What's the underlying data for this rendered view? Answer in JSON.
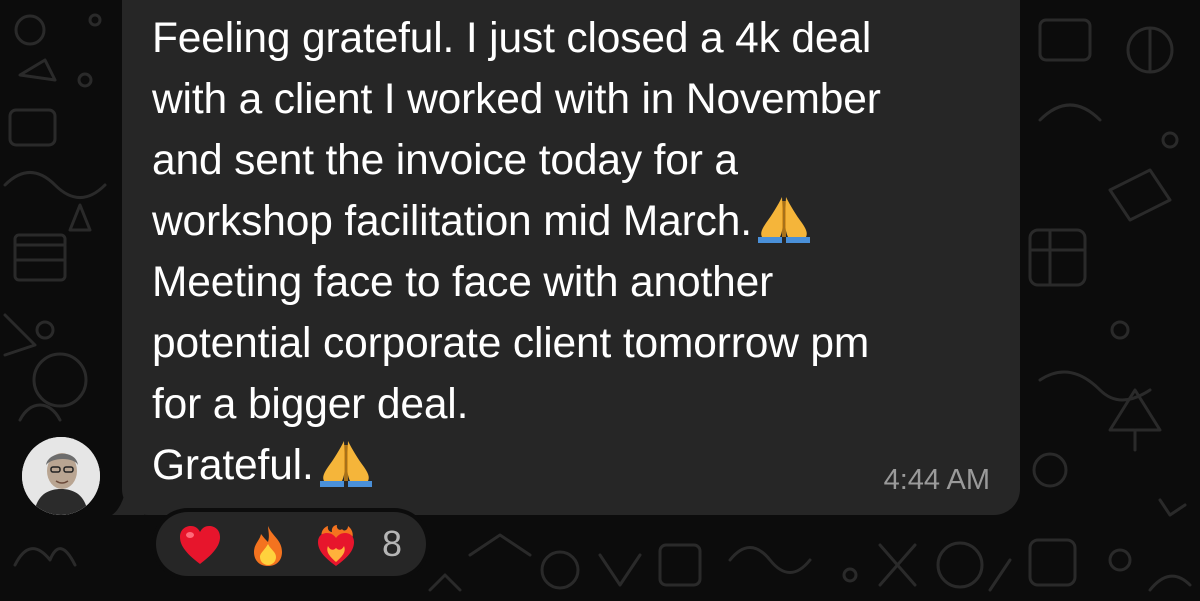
{
  "message": {
    "text_lines": [
      "Feeling grateful. I just closed a 4k deal",
      "with a client I worked with in November",
      "and sent the invoice today for a",
      "workshop facilitation mid March.",
      "Meeting face to face with another",
      "potential corporate client tomorrow pm",
      "for a bigger deal.",
      "Grateful."
    ],
    "emoji_after_line_4": "pray-emoji",
    "emoji_after_line_8": "pray-emoji",
    "timestamp": "4:44 AM"
  },
  "sender": {
    "avatar": "avatar-photo"
  },
  "reactions": {
    "items": [
      {
        "icon": "red-heart-emoji"
      },
      {
        "icon": "fire-emoji"
      },
      {
        "icon": "heart-on-fire-emoji"
      }
    ],
    "count": "8"
  },
  "colors": {
    "background": "#0c0c0c",
    "bubble": "#262626",
    "text": "#ffffff",
    "meta": "#9a9a9a"
  }
}
